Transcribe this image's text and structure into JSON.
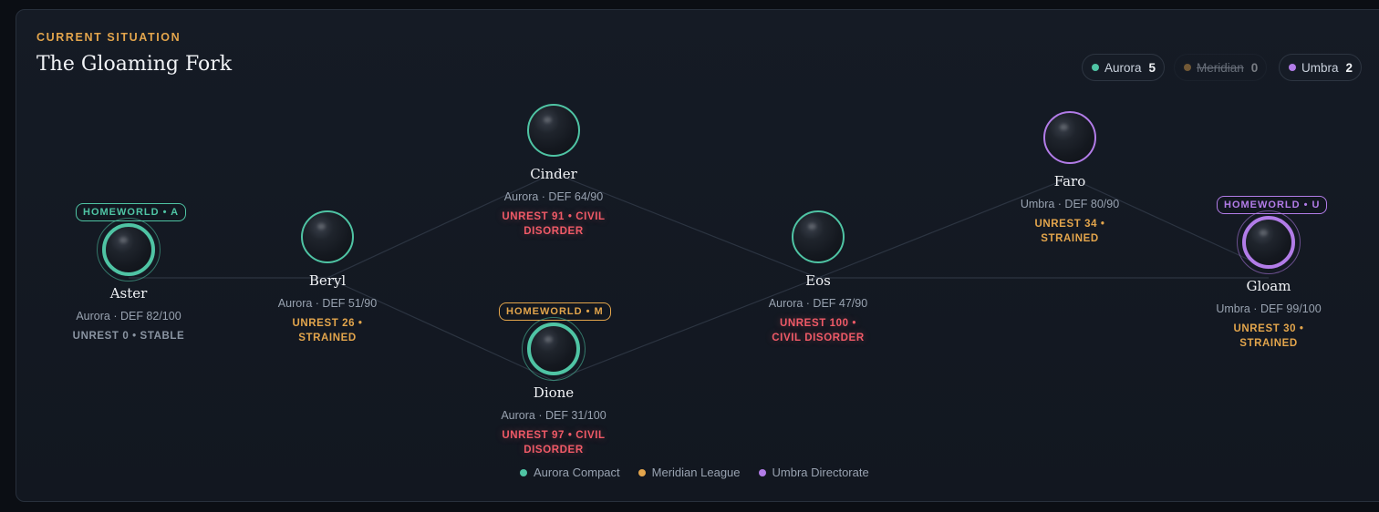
{
  "header": {
    "eyebrow": "CURRENT SITUATION",
    "title": "The Gloaming Fork"
  },
  "factions": [
    {
      "name": "Aurora",
      "count": "5",
      "color": "#4fc4a4",
      "dimmed": false
    },
    {
      "name": "Meridian",
      "count": "0",
      "color": "#e3a54c",
      "dimmed": true
    },
    {
      "name": "Umbra",
      "count": "2",
      "color": "#b27ce8",
      "dimmed": false
    }
  ],
  "planets": [
    {
      "name": "Aster",
      "faction": "aurora",
      "meta": "Aurora · DEF 82/100",
      "unrest": "UNREST 0 • STABLE",
      "level": "stable",
      "homeworld": "HOMEWORLD • A"
    },
    {
      "name": "Beryl",
      "faction": "aurora",
      "meta": "Aurora · DEF 51/90",
      "unrest": "UNREST 26 • STRAINED",
      "level": "strained",
      "homeworld": ""
    },
    {
      "name": "Cinder",
      "faction": "aurora",
      "meta": "Aurora · DEF 64/90",
      "unrest": "UNREST 91 • CIVIL DISORDER",
      "level": "civil",
      "homeworld": ""
    },
    {
      "name": "Dione",
      "faction": "aurora",
      "meta": "Aurora · DEF 31/100",
      "unrest": "UNREST 97 • CIVIL DISORDER",
      "level": "civil",
      "homeworld": "HOMEWORLD • M"
    },
    {
      "name": "Eos",
      "faction": "aurora",
      "meta": "Aurora · DEF 47/90",
      "unrest": "UNREST 100 • CIVIL DISORDER",
      "level": "civil",
      "homeworld": ""
    },
    {
      "name": "Faro",
      "faction": "umbra",
      "meta": "Umbra · DEF 80/90",
      "unrest": "UNREST 34 • STRAINED",
      "level": "strained",
      "homeworld": ""
    },
    {
      "name": "Gloam",
      "faction": "umbra",
      "meta": "Umbra · DEF 99/100",
      "unrest": "UNREST 30 • STRAINED",
      "level": "strained",
      "homeworld": "HOMEWORLD • U"
    }
  ],
  "legend": [
    {
      "label": "Aurora Compact",
      "color": "#4fc4a4"
    },
    {
      "label": "Meridian League",
      "color": "#e3a54c"
    },
    {
      "label": "Umbra Directorate",
      "color": "#b27ce8"
    }
  ],
  "colors": {
    "aurora": "#4fc4a4",
    "meridian": "#e3a54c",
    "umbra": "#b27ce8"
  }
}
